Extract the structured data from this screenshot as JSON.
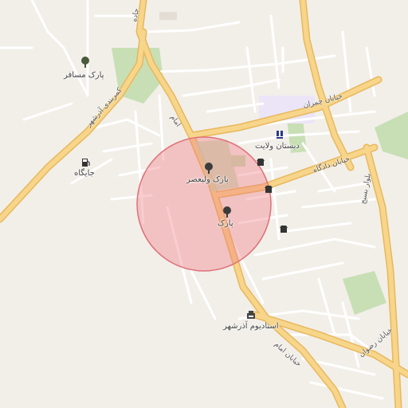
{
  "map": {
    "colors": {
      "background": "#f2efe9",
      "park": "#c8dfb5",
      "major_road": "#f7d58a",
      "major_road_outline": "#e8b85c",
      "minor_road": "#ffffff",
      "highlight_circle_fill": "rgba(240,120,130,0.38)",
      "highlight_circle_stroke": "#e0707a",
      "building": "#e3ddd6",
      "school_zone": "#e8e0f5"
    },
    "labels": {
      "park_mosafer": "پارک مسافر",
      "road_kamarbandi": "کمربندی آذرشهر",
      "road_jadeh": "جاده",
      "road_imam_north": "امام",
      "gas_station": "جایگاه",
      "park_valiasr": "پارک ولیعصر",
      "park_small": "پارک",
      "school": "دبستان ولایت",
      "street_chamran": "خیابان چمران",
      "street_dadgah": "خیابان دادگاه",
      "blvd_basij": "بلوار بسیج",
      "stadium": "استادیوم آذرشهر",
      "street_imam": "خیابان امام",
      "street_rezvan": "خیابان رضوان"
    },
    "icons": [
      "tree-icon",
      "tree-icon",
      "tree-icon",
      "fuel-icon",
      "school-icon",
      "shop-icon",
      "shop-icon",
      "stadium-icon",
      "shop-icon"
    ]
  }
}
